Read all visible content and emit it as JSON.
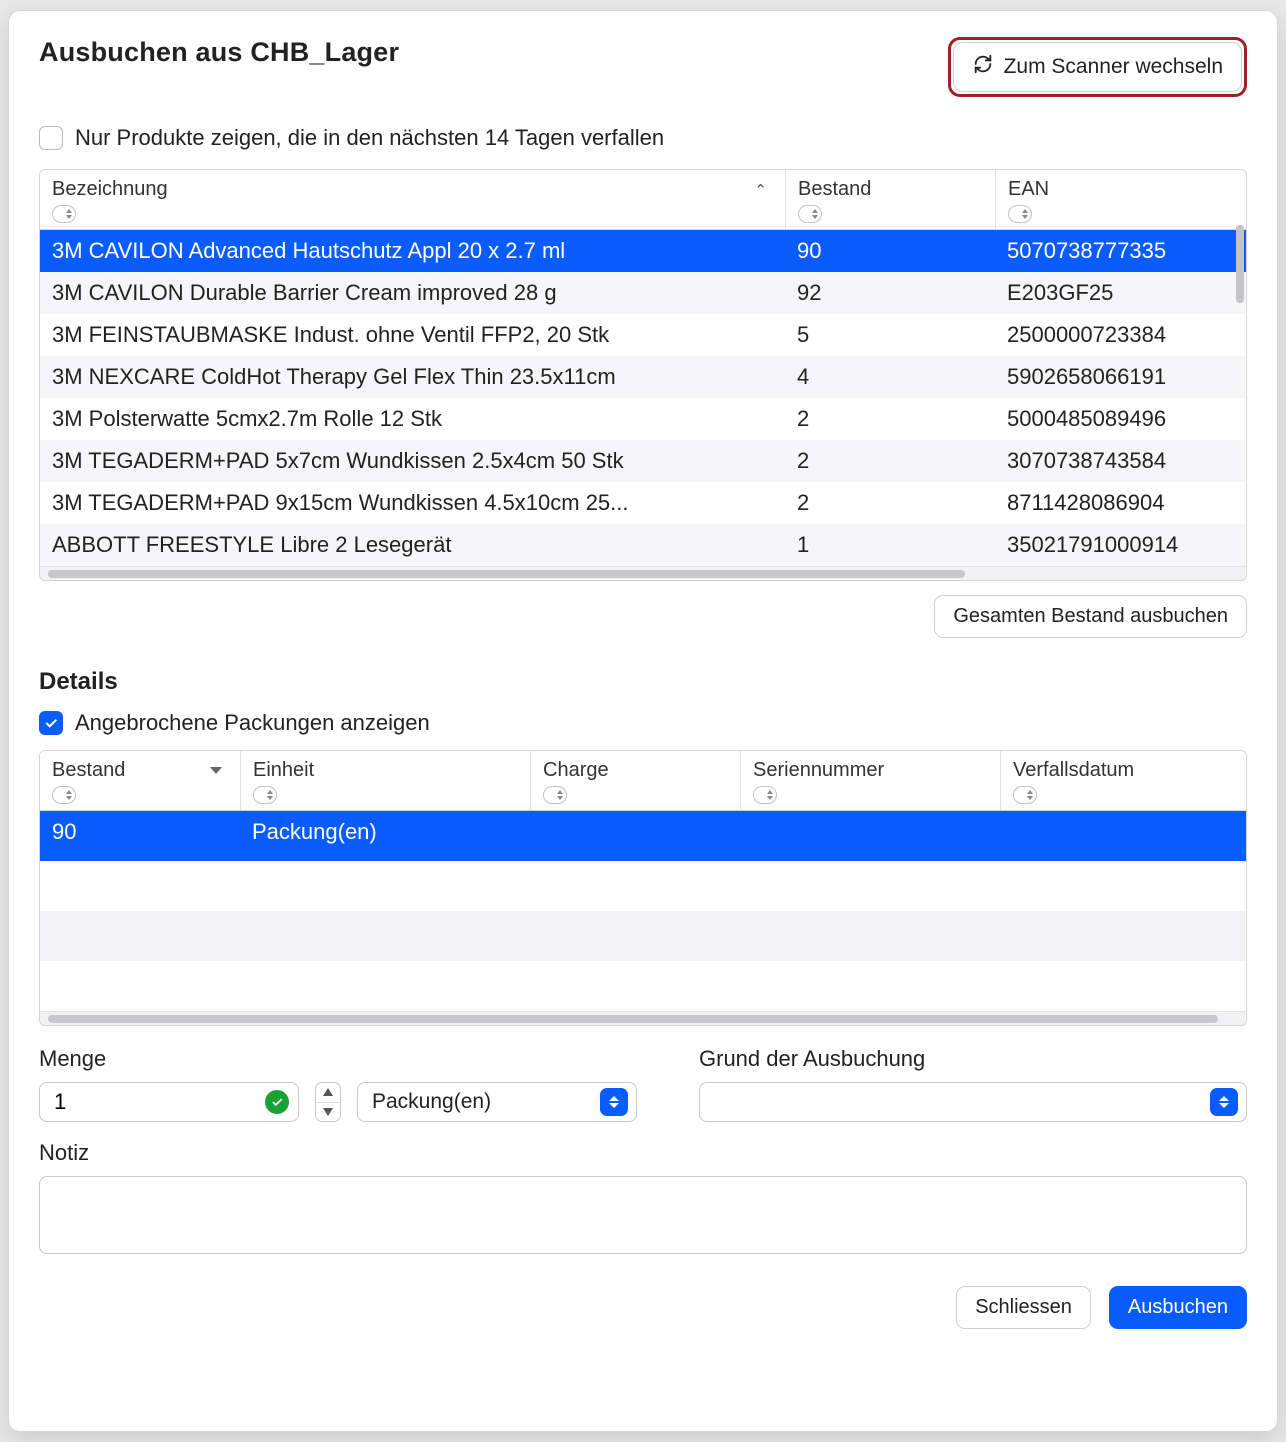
{
  "title": "Ausbuchen aus CHB_Lager",
  "scanner_button": "Zum Scanner wechseln",
  "checkbox_expiring": {
    "label": "Nur Produkte zeigen, die in den nächsten 14 Tagen verfallen",
    "checked": false
  },
  "main_table": {
    "columns": {
      "name": "Bezeichnung",
      "stock": "Bestand",
      "ean": "EAN"
    },
    "rows": [
      {
        "name": "3M CAVILON Advanced Hautschutz Appl 20 x 2.7 ml",
        "stock": "90",
        "ean": "5070738777335",
        "selected": true
      },
      {
        "name": "3M CAVILON Durable Barrier Cream improved 28 g",
        "stock": "92",
        "ean": "E203GF25"
      },
      {
        "name": "3M FEINSTAUBMASKE Indust. ohne Ventil FFP2, 20 Stk",
        "stock": "5",
        "ean": "2500000723384"
      },
      {
        "name": "3M NEXCARE ColdHot Therapy Gel Flex Thin 23.5x11cm",
        "stock": "4",
        "ean": "5902658066191"
      },
      {
        "name": "3M Polsterwatte 5cmx2.7m Rolle 12 Stk",
        "stock": "2",
        "ean": "5000485089496"
      },
      {
        "name": "3M TEGADERM+PAD 5x7cm Wundkissen 2.5x4cm 50 Stk",
        "stock": "2",
        "ean": "3070738743584"
      },
      {
        "name": "3M TEGADERM+PAD 9x15cm Wundkissen 4.5x10cm 25...",
        "stock": "2",
        "ean": "8711428086904"
      },
      {
        "name": "ABBOTT FREESTYLE Libre 2 Lesegerät",
        "stock": "1",
        "ean": "35021791000914"
      }
    ]
  },
  "book_all_button": "Gesamten Bestand ausbuchen",
  "details": {
    "title": "Details",
    "show_open_packs": {
      "label": "Angebrochene Packungen anzeigen",
      "checked": true
    },
    "columns": {
      "stock": "Bestand",
      "unit": "Einheit",
      "charge": "Charge",
      "serial": "Seriennummer",
      "expiry": "Verfallsdatum"
    },
    "rows": [
      {
        "stock": "90",
        "unit": "Packung(en)",
        "charge": "",
        "serial": "",
        "expiry": "",
        "selected": true
      }
    ]
  },
  "form": {
    "qty_label": "Menge",
    "qty_value": "1",
    "unit_value": "Packung(en)",
    "reason_label": "Grund der Ausbuchung",
    "reason_value": "",
    "note_label": "Notiz",
    "note_value": ""
  },
  "footer": {
    "close": "Schliessen",
    "submit": "Ausbuchen"
  }
}
